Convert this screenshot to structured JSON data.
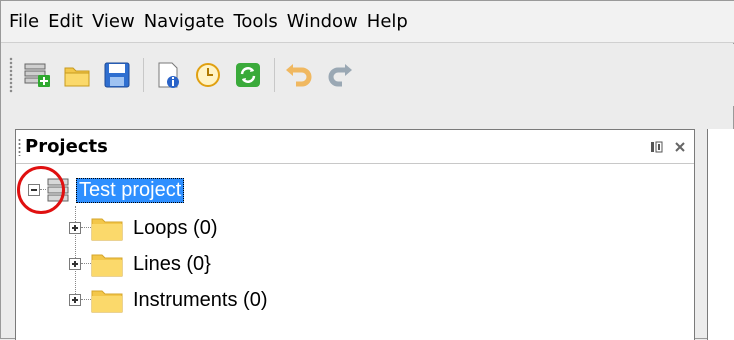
{
  "menubar": {
    "items": [
      "File",
      "Edit",
      "View",
      "Navigate",
      "Tools",
      "Window",
      "Help"
    ]
  },
  "toolbar": {
    "buttons": [
      {
        "icon": "new-project-icon"
      },
      {
        "icon": "open-project-icon"
      },
      {
        "icon": "save-icon"
      },
      {
        "icon": "properties-icon"
      },
      {
        "icon": "clock-icon"
      },
      {
        "icon": "refresh-icon"
      },
      {
        "icon": "undo-icon"
      },
      {
        "icon": "redo-icon"
      }
    ]
  },
  "projects_panel": {
    "title": "Projects",
    "tree": {
      "root": {
        "label": "Test project",
        "expanded": true,
        "selected": true
      },
      "children": [
        {
          "label": "Loops (0)"
        },
        {
          "label": "Lines (0}"
        },
        {
          "label": "Instruments (0)"
        }
      ]
    }
  },
  "colors": {
    "selection": "#2e8fff",
    "folder": "#f7c948",
    "annotation_circle": "#e01010"
  }
}
